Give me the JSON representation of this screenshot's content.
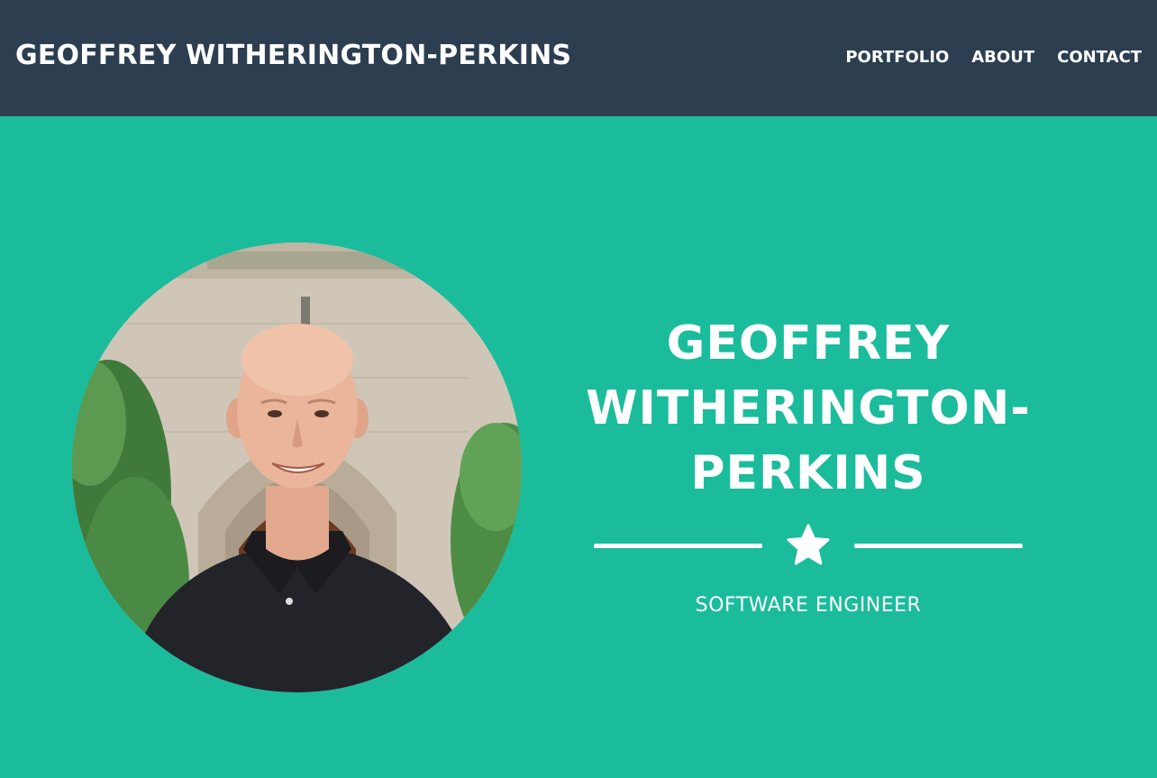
{
  "header": {
    "brand": "GEOFFREY WITHERINGTON-PERKINS",
    "nav": [
      {
        "label": "PORTFOLIO"
      },
      {
        "label": "ABOUT"
      },
      {
        "label": "CONTACT"
      }
    ]
  },
  "hero": {
    "name_line1": "GEOFFREY",
    "name_line2": "WITHERINGTON-",
    "name_line3": "PERKINS",
    "tagline": "SOFTWARE ENGINEER",
    "divider_icon": "star-icon"
  },
  "colors": {
    "navbar": "#2c3e50",
    "hero_background": "#1abc9c",
    "text": "#ffffff"
  }
}
